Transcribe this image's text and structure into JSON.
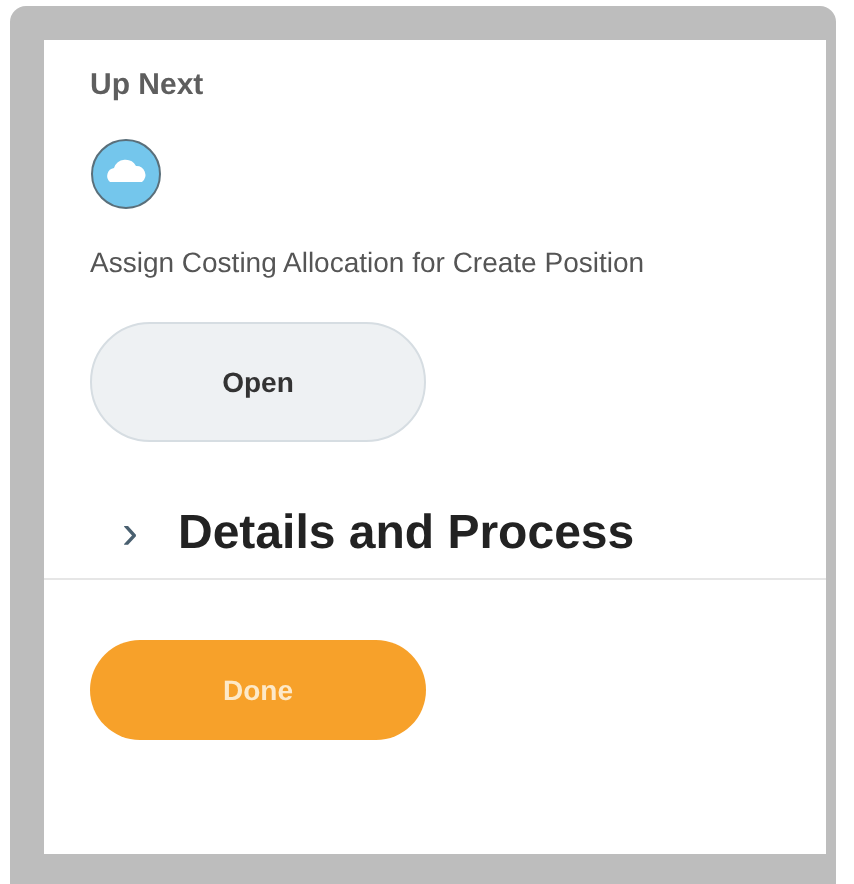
{
  "heading": "Up Next",
  "task": "Assign Costing Allocation for Create Position",
  "open_button": "Open",
  "section": {
    "title": "Details and Process",
    "expanded": false,
    "chevron": "›"
  },
  "done_button": "Done"
}
